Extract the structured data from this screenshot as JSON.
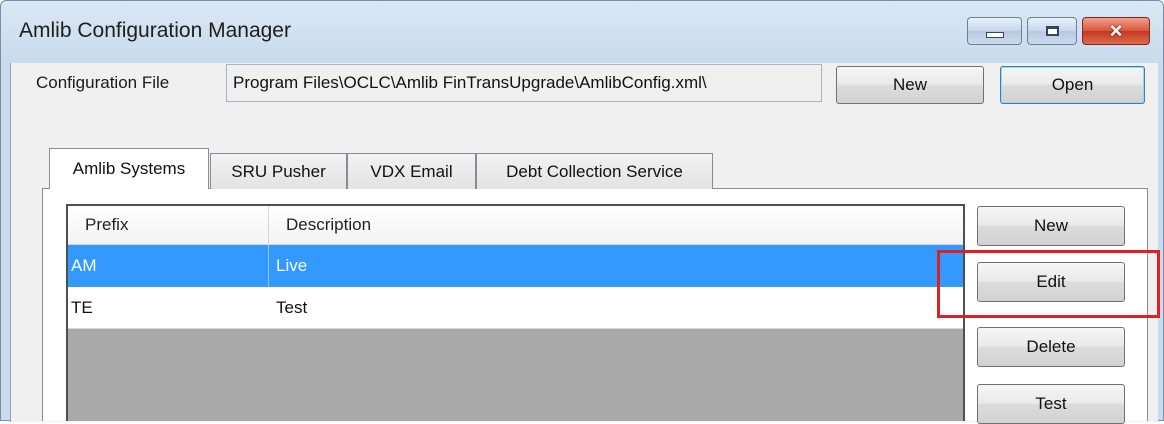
{
  "window": {
    "title": "Amlib Configuration Manager",
    "controls": {
      "minimize": "minimize",
      "maximize": "maximize",
      "close": "×"
    }
  },
  "config": {
    "label": "Configuration File",
    "path": "\\Program Files\\OCLC\\Amlib FinTransUpgrade\\AmlibConfig.xml",
    "new_label": "New",
    "open_label": "Open"
  },
  "tabs": [
    {
      "label": "Amlib Systems",
      "active": true
    },
    {
      "label": "SRU Pusher",
      "active": false
    },
    {
      "label": "VDX Email",
      "active": false
    },
    {
      "label": "Debt Collection Service",
      "active": false
    }
  ],
  "grid": {
    "columns": [
      "Prefix",
      "Description"
    ],
    "rows": [
      {
        "prefix": "AM",
        "description": "Live",
        "selected": true
      },
      {
        "prefix": "TE",
        "description": "Test",
        "selected": false
      }
    ]
  },
  "side_buttons": {
    "new": "New",
    "edit": "Edit",
    "delete": "Delete",
    "test": "Test"
  },
  "colors": {
    "selection": "#3399ff",
    "highlight": "#e02020",
    "close_button": "#c13a20"
  }
}
